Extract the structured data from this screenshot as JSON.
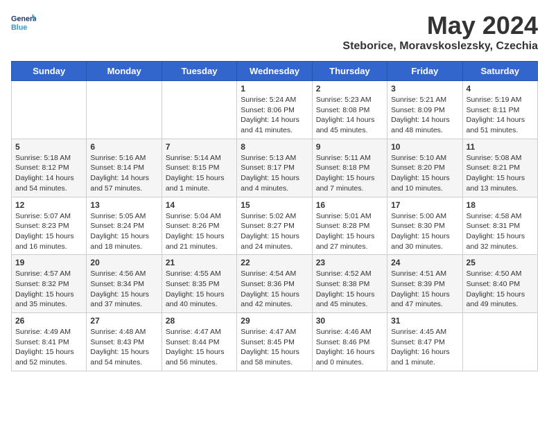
{
  "header": {
    "logo_line1": "General",
    "logo_line2": "Blue",
    "month_title": "May 2024",
    "location": "Steborice, Moravskoslezsky, Czechia"
  },
  "days_of_week": [
    "Sunday",
    "Monday",
    "Tuesday",
    "Wednesday",
    "Thursday",
    "Friday",
    "Saturday"
  ],
  "weeks": [
    [
      {
        "day": "",
        "text": ""
      },
      {
        "day": "",
        "text": ""
      },
      {
        "day": "",
        "text": ""
      },
      {
        "day": "1",
        "text": "Sunrise: 5:24 AM\nSunset: 8:06 PM\nDaylight: 14 hours\nand 41 minutes."
      },
      {
        "day": "2",
        "text": "Sunrise: 5:23 AM\nSunset: 8:08 PM\nDaylight: 14 hours\nand 45 minutes."
      },
      {
        "day": "3",
        "text": "Sunrise: 5:21 AM\nSunset: 8:09 PM\nDaylight: 14 hours\nand 48 minutes."
      },
      {
        "day": "4",
        "text": "Sunrise: 5:19 AM\nSunset: 8:11 PM\nDaylight: 14 hours\nand 51 minutes."
      }
    ],
    [
      {
        "day": "5",
        "text": "Sunrise: 5:18 AM\nSunset: 8:12 PM\nDaylight: 14 hours\nand 54 minutes."
      },
      {
        "day": "6",
        "text": "Sunrise: 5:16 AM\nSunset: 8:14 PM\nDaylight: 14 hours\nand 57 minutes."
      },
      {
        "day": "7",
        "text": "Sunrise: 5:14 AM\nSunset: 8:15 PM\nDaylight: 15 hours\nand 1 minute."
      },
      {
        "day": "8",
        "text": "Sunrise: 5:13 AM\nSunset: 8:17 PM\nDaylight: 15 hours\nand 4 minutes."
      },
      {
        "day": "9",
        "text": "Sunrise: 5:11 AM\nSunset: 8:18 PM\nDaylight: 15 hours\nand 7 minutes."
      },
      {
        "day": "10",
        "text": "Sunrise: 5:10 AM\nSunset: 8:20 PM\nDaylight: 15 hours\nand 10 minutes."
      },
      {
        "day": "11",
        "text": "Sunrise: 5:08 AM\nSunset: 8:21 PM\nDaylight: 15 hours\nand 13 minutes."
      }
    ],
    [
      {
        "day": "12",
        "text": "Sunrise: 5:07 AM\nSunset: 8:23 PM\nDaylight: 15 hours\nand 16 minutes."
      },
      {
        "day": "13",
        "text": "Sunrise: 5:05 AM\nSunset: 8:24 PM\nDaylight: 15 hours\nand 18 minutes."
      },
      {
        "day": "14",
        "text": "Sunrise: 5:04 AM\nSunset: 8:26 PM\nDaylight: 15 hours\nand 21 minutes."
      },
      {
        "day": "15",
        "text": "Sunrise: 5:02 AM\nSunset: 8:27 PM\nDaylight: 15 hours\nand 24 minutes."
      },
      {
        "day": "16",
        "text": "Sunrise: 5:01 AM\nSunset: 8:28 PM\nDaylight: 15 hours\nand 27 minutes."
      },
      {
        "day": "17",
        "text": "Sunrise: 5:00 AM\nSunset: 8:30 PM\nDaylight: 15 hours\nand 30 minutes."
      },
      {
        "day": "18",
        "text": "Sunrise: 4:58 AM\nSunset: 8:31 PM\nDaylight: 15 hours\nand 32 minutes."
      }
    ],
    [
      {
        "day": "19",
        "text": "Sunrise: 4:57 AM\nSunset: 8:32 PM\nDaylight: 15 hours\nand 35 minutes."
      },
      {
        "day": "20",
        "text": "Sunrise: 4:56 AM\nSunset: 8:34 PM\nDaylight: 15 hours\nand 37 minutes."
      },
      {
        "day": "21",
        "text": "Sunrise: 4:55 AM\nSunset: 8:35 PM\nDaylight: 15 hours\nand 40 minutes."
      },
      {
        "day": "22",
        "text": "Sunrise: 4:54 AM\nSunset: 8:36 PM\nDaylight: 15 hours\nand 42 minutes."
      },
      {
        "day": "23",
        "text": "Sunrise: 4:52 AM\nSunset: 8:38 PM\nDaylight: 15 hours\nand 45 minutes."
      },
      {
        "day": "24",
        "text": "Sunrise: 4:51 AM\nSunset: 8:39 PM\nDaylight: 15 hours\nand 47 minutes."
      },
      {
        "day": "25",
        "text": "Sunrise: 4:50 AM\nSunset: 8:40 PM\nDaylight: 15 hours\nand 49 minutes."
      }
    ],
    [
      {
        "day": "26",
        "text": "Sunrise: 4:49 AM\nSunset: 8:41 PM\nDaylight: 15 hours\nand 52 minutes."
      },
      {
        "day": "27",
        "text": "Sunrise: 4:48 AM\nSunset: 8:43 PM\nDaylight: 15 hours\nand 54 minutes."
      },
      {
        "day": "28",
        "text": "Sunrise: 4:47 AM\nSunset: 8:44 PM\nDaylight: 15 hours\nand 56 minutes."
      },
      {
        "day": "29",
        "text": "Sunrise: 4:47 AM\nSunset: 8:45 PM\nDaylight: 15 hours\nand 58 minutes."
      },
      {
        "day": "30",
        "text": "Sunrise: 4:46 AM\nSunset: 8:46 PM\nDaylight: 16 hours\nand 0 minutes."
      },
      {
        "day": "31",
        "text": "Sunrise: 4:45 AM\nSunset: 8:47 PM\nDaylight: 16 hours\nand 1 minute."
      },
      {
        "day": "",
        "text": ""
      }
    ]
  ]
}
